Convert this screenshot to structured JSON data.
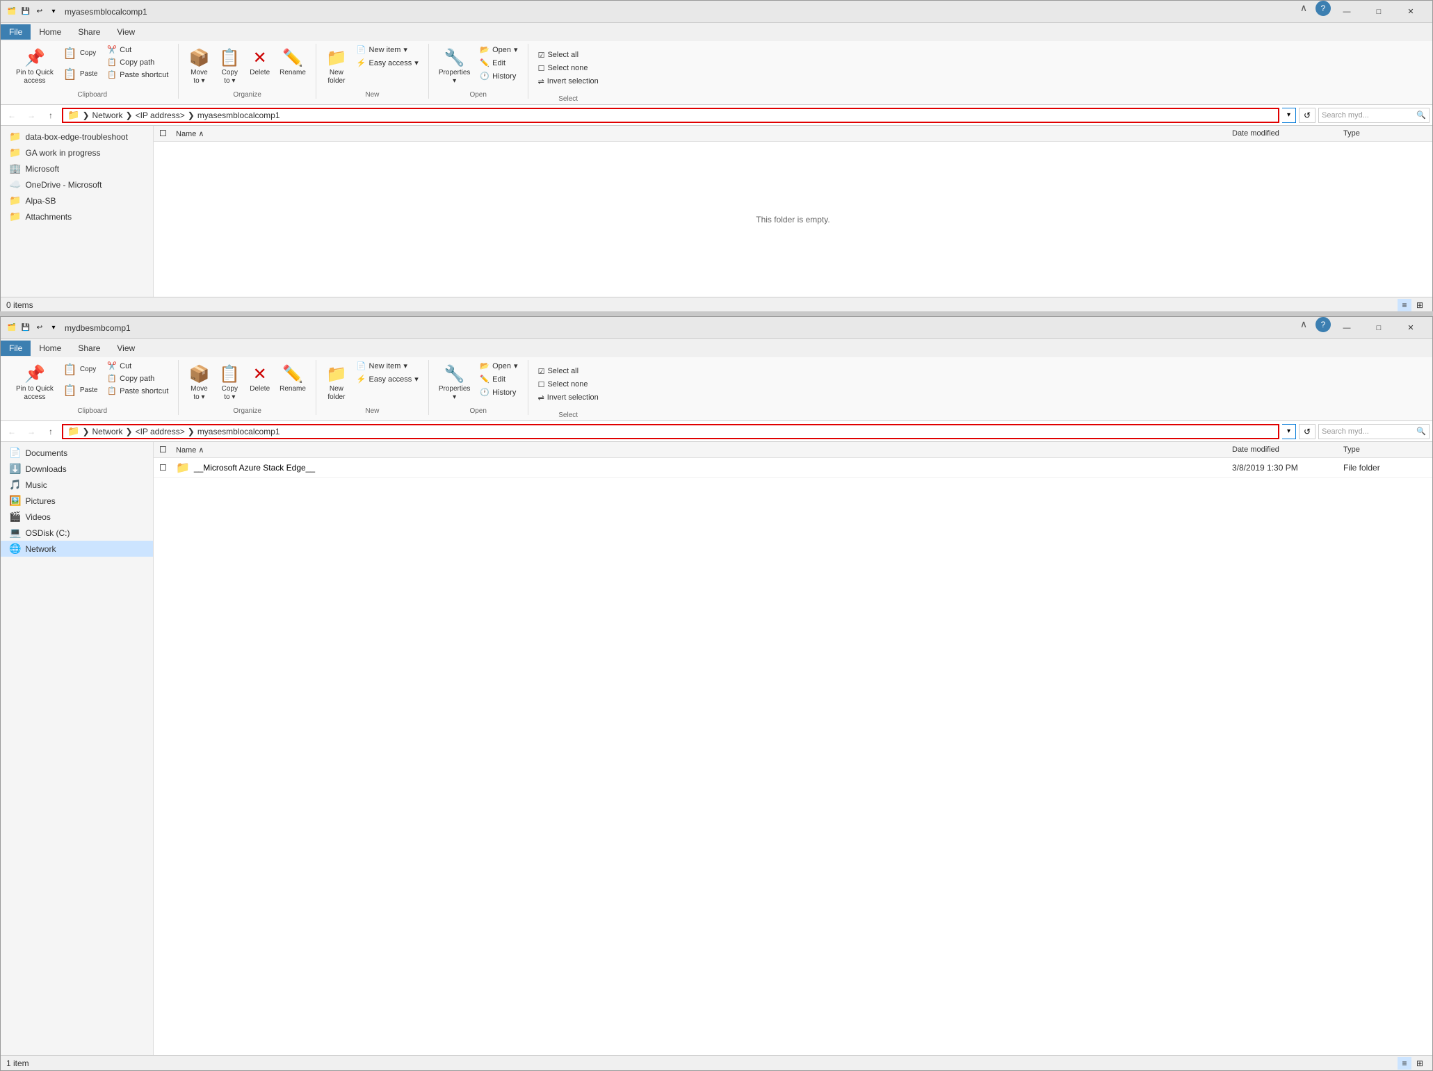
{
  "window1": {
    "title": "myasesmblocalcomp1",
    "tabs": [
      "File",
      "Home",
      "Share",
      "View"
    ],
    "active_tab": "Home",
    "ribbon": {
      "clipboard": {
        "label": "Clipboard",
        "pin_label": "Pin to Quick\naccess",
        "copy_label": "Copy",
        "paste_label": "Paste",
        "cut": "Cut",
        "copy_path": "Copy path",
        "paste_shortcut": "Paste shortcut"
      },
      "organize": {
        "label": "Organize",
        "move_to": "Move\nto",
        "copy_to": "Copy\nto",
        "delete": "Delete",
        "rename": "Rename",
        "new_folder": "New\nfolder"
      },
      "new": {
        "label": "New",
        "new_item": "New item",
        "easy_access": "Easy access"
      },
      "open": {
        "label": "Open",
        "open": "Open",
        "edit": "Edit",
        "history": "History",
        "properties": "Properties"
      },
      "select": {
        "label": "Select",
        "select_all": "Select all",
        "select_none": "Select none",
        "invert": "Invert selection"
      }
    },
    "address": {
      "path": "Network > <IP address> > myasesmblocalcomp1",
      "parts": [
        "Network",
        "<IP address>",
        "myasesmblocalcomp1"
      ],
      "search_placeholder": "Search myd..."
    },
    "sidebar_items": [
      {
        "icon": "📁",
        "label": "data-box-edge-troubleshoot"
      },
      {
        "icon": "📁",
        "label": "GA work in progress"
      },
      {
        "icon": "🏢",
        "label": "Microsoft"
      },
      {
        "icon": "☁️",
        "label": "OneDrive - Microsoft"
      },
      {
        "icon": "📁",
        "label": "Alpa-SB"
      },
      {
        "icon": "📁",
        "label": "Attachments"
      }
    ],
    "file_list": {
      "columns": [
        "Name",
        "Date modified",
        "Type"
      ],
      "items": [],
      "empty_message": "This folder is empty."
    },
    "status": "0 items"
  },
  "window2": {
    "title": "mydbesmbcomp1",
    "tabs": [
      "File",
      "Home",
      "Share",
      "View"
    ],
    "active_tab": "Home",
    "ribbon": {
      "clipboard": {
        "label": "Clipboard",
        "pin_label": "Pin to Quick\naccess",
        "copy_label": "Copy",
        "paste_label": "Paste",
        "cut": "Cut",
        "copy_path": "Copy path",
        "paste_shortcut": "Paste shortcut"
      },
      "organize": {
        "label": "Organize",
        "move_to": "Move\nto",
        "copy_to": "Copy\nto",
        "delete": "Delete",
        "rename": "Rename",
        "new_folder": "New\nfolder"
      },
      "new": {
        "label": "New",
        "new_item": "New item",
        "easy_access": "Easy access"
      },
      "open": {
        "label": "Open",
        "open": "Open",
        "edit": "Edit",
        "history": "History",
        "properties": "Properties"
      },
      "select": {
        "label": "Select",
        "select_all": "Select all",
        "select_none": "Select none",
        "invert": "Invert selection"
      }
    },
    "address": {
      "path": "Network > <IP address> > myasesmblocalcomp1",
      "parts": [
        "Network",
        "<IP address>",
        "myasesmblocalcomp1"
      ],
      "search_placeholder": "Search myd..."
    },
    "sidebar_items": [
      {
        "icon": "📄",
        "label": "Documents"
      },
      {
        "icon": "⬇️",
        "label": "Downloads"
      },
      {
        "icon": "🎵",
        "label": "Music"
      },
      {
        "icon": "🖼️",
        "label": "Pictures"
      },
      {
        "icon": "🎬",
        "label": "Videos"
      },
      {
        "icon": "💻",
        "label": "OSDisk (C:)"
      },
      {
        "icon": "🌐",
        "label": "Network",
        "selected": true
      }
    ],
    "file_list": {
      "columns": [
        "Name",
        "Date modified",
        "Type"
      ],
      "items": [
        {
          "icon": "📁",
          "name": "__Microsoft Azure Stack Edge__",
          "date": "3/8/2019  1:30 PM",
          "type": "File folder"
        }
      ]
    },
    "status": "1 item"
  },
  "icons": {
    "pin": "📌",
    "copy": "📋",
    "paste": "📋",
    "cut": "✂️",
    "move": "→",
    "delete": "✕",
    "rename": "✏️",
    "new_folder": "📁",
    "new_item": "📄",
    "properties": "🔧",
    "open": "📂",
    "edit": "✏️",
    "history": "🕐",
    "check": "✓",
    "back": "←",
    "forward": "→",
    "up": "↑",
    "refresh": "↺",
    "help": "?",
    "collapse": "∧",
    "minimize": "—",
    "maximize": "□",
    "close": "✕",
    "chevron_down": "▾",
    "folder": "📁",
    "network_folder": "🌐"
  }
}
